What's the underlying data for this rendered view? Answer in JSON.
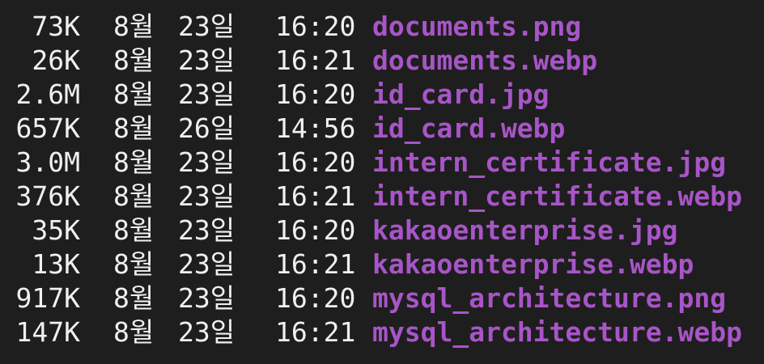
{
  "listing": {
    "rows": [
      {
        "size": "73K",
        "month": "8월",
        "day": "23일",
        "time": "16:20",
        "name": "documents.png"
      },
      {
        "size": "26K",
        "month": "8월",
        "day": "23일",
        "time": "16:21",
        "name": "documents.webp"
      },
      {
        "size": "2.6M",
        "month": "8월",
        "day": "23일",
        "time": "16:20",
        "name": "id_card.jpg"
      },
      {
        "size": "657K",
        "month": "8월",
        "day": "26일",
        "time": "14:56",
        "name": "id_card.webp"
      },
      {
        "size": "3.0M",
        "month": "8월",
        "day": "23일",
        "time": "16:20",
        "name": "intern_certificate.jpg"
      },
      {
        "size": "376K",
        "month": "8월",
        "day": "23일",
        "time": "16:21",
        "name": "intern_certificate.webp"
      },
      {
        "size": "35K",
        "month": "8월",
        "day": "23일",
        "time": "16:20",
        "name": "kakaoenterprise.jpg"
      },
      {
        "size": "13K",
        "month": "8월",
        "day": "23일",
        "time": "16:21",
        "name": "kakaoenterprise.webp"
      },
      {
        "size": "917K",
        "month": "8월",
        "day": "23일",
        "time": "16:20",
        "name": "mysql_architecture.png"
      },
      {
        "size": "147K",
        "month": "8월",
        "day": "23일",
        "time": "16:21",
        "name": "mysql_architecture.webp"
      }
    ]
  },
  "colors": {
    "background": "#1e1e1e",
    "text": "#f0f0f0",
    "filename": "#a855c8"
  }
}
